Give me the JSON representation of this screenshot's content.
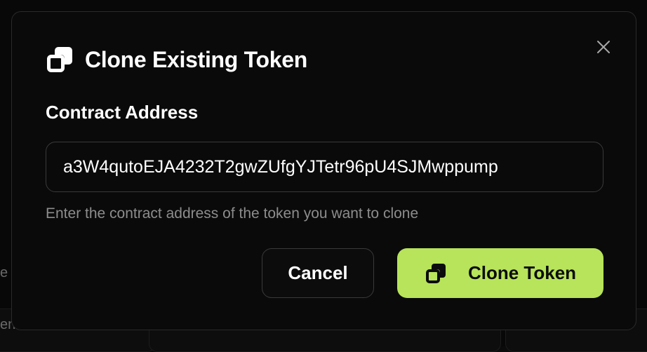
{
  "dialog": {
    "title": "Clone Existing Token",
    "title_icon": "copy-icon",
    "close_icon": "close-icon",
    "field_label": "Contract Address",
    "address_value": "a3W4qutoEJA4232T2gwZUfgYJTetr96pU4SJMwppump",
    "hint": "Enter the contract address of the token you want to clone",
    "cancel_label": "Cancel",
    "clone_label": "Clone Token",
    "clone_icon": "copy-icon"
  },
  "background": {
    "fragment_left_top": "e",
    "fragment_left_bottom": "en"
  },
  "colors": {
    "accent": "#b7e45a",
    "background": "#0a0a0a",
    "border": "#3a3a3a",
    "hint_text": "#8d8d8d"
  }
}
